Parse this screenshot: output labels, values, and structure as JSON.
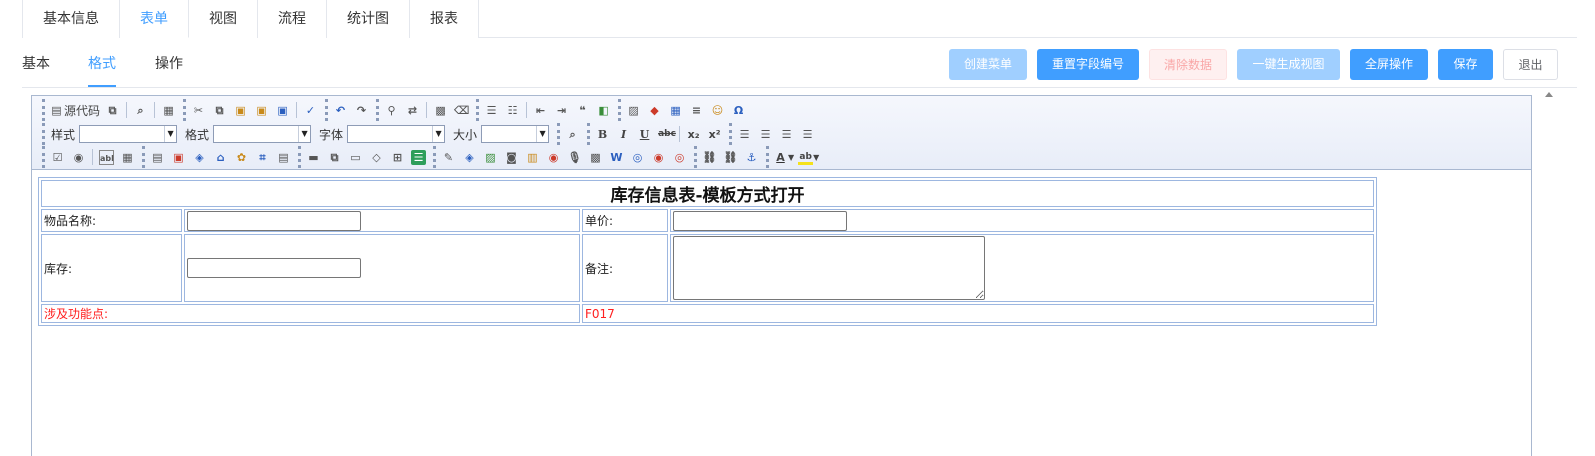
{
  "top_tabs": [
    {
      "label": "基本信息"
    },
    {
      "label": "表单"
    },
    {
      "label": "视图"
    },
    {
      "label": "流程"
    },
    {
      "label": "统计图"
    },
    {
      "label": "报表"
    }
  ],
  "sub_tabs": [
    {
      "label": "基本"
    },
    {
      "label": "格式"
    },
    {
      "label": "操作"
    }
  ],
  "actions": {
    "create_menu": "创建菜单",
    "reset_field_numbers": "重置字段编号",
    "clear_data": "清除数据",
    "one_click_view": "一键生成视图",
    "fullscreen": "全屏操作",
    "save": "保存",
    "exit": "退出"
  },
  "toolbar": {
    "source_code": "源代码",
    "style_label": "样式",
    "format_label": "格式",
    "font_label": "字体",
    "size_label": "大小",
    "font_color_glyph": "A",
    "highlight_glyph": "ab"
  },
  "document": {
    "title": "库存信息表-模板方式打开",
    "item_name_label": "物品名称:",
    "unit_price_label": "单价:",
    "stock_label": "库存:",
    "remarks_label": "备注:",
    "feature_point_label": "涉及功能点:",
    "feature_point_value": "F017"
  },
  "colors": {
    "accent": "#409eff",
    "accent_disabled": "#a0cfff",
    "danger_text": "#ff2020"
  }
}
